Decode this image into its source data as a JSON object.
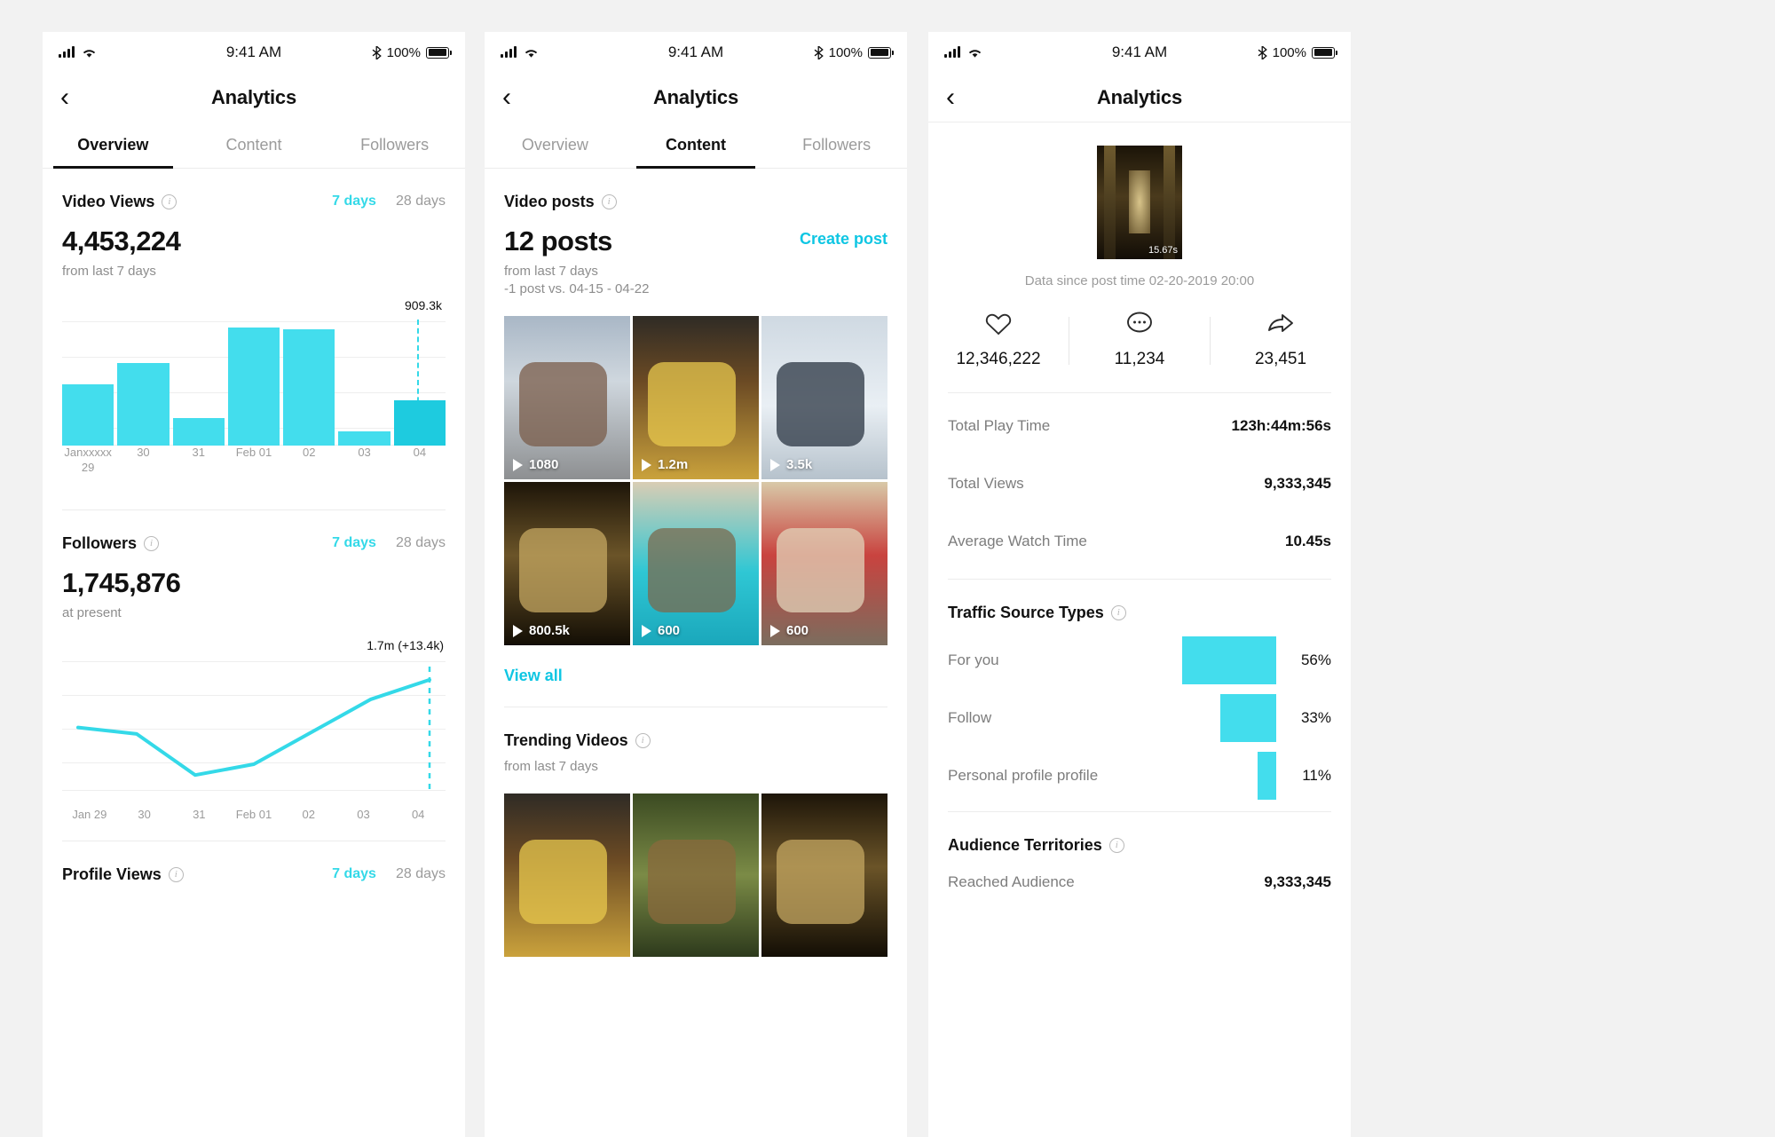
{
  "status_bar": {
    "time": "9:41 AM",
    "battery": "100%",
    "icons": [
      "signal-bars-icon",
      "wifi-icon",
      "bluetooth-icon",
      "battery-icon"
    ]
  },
  "colors": {
    "accent": "#34d9e8",
    "bar": "#43dded",
    "bar_highlight": "#1ecbdf",
    "link": "#0fc6e3",
    "text": "#111111",
    "muted": "#9b9b9b"
  },
  "nav": {
    "title": "Analytics",
    "back_icon": "chevron-left-icon"
  },
  "panel1": {
    "tabs": [
      {
        "label": "Overview",
        "active": true
      },
      {
        "label": "Content",
        "active": false
      },
      {
        "label": "Followers",
        "active": false
      }
    ],
    "video_views": {
      "title": "Video Views",
      "range_7": "7 days",
      "range_28": "28 days",
      "value": "4,453,224",
      "subtitle": "from last 7 days",
      "peak_label": "909.3k"
    },
    "followers": {
      "title": "Followers",
      "range_7": "7 days",
      "range_28": "28 days",
      "value": "1,745,876",
      "subtitle": "at present",
      "peak_label": "1.7m (+13.4k)"
    },
    "profile_views": {
      "title": "Profile Views",
      "range_7": "7 days",
      "range_28": "28 days"
    }
  },
  "panel2": {
    "tabs": [
      {
        "label": "Overview",
        "active": false
      },
      {
        "label": "Content",
        "active": true
      },
      {
        "label": "Followers",
        "active": false
      }
    ],
    "video_posts": {
      "title": "Video posts",
      "value": "12 posts",
      "subtitle": "from last 7 days",
      "subtitle2": "-1 post vs. 04-15 - 04-22",
      "create_post": "Create post",
      "view_all": "View all",
      "posts": [
        {
          "plays": "1080",
          "theme": "city"
        },
        {
          "plays": "1.2m",
          "theme": "burger"
        },
        {
          "plays": "3.5k",
          "theme": "snow"
        },
        {
          "plays": "800.5k",
          "theme": "corridor"
        },
        {
          "plays": "600",
          "theme": "venice"
        },
        {
          "plays": "600",
          "theme": "cafe"
        }
      ]
    },
    "trending": {
      "title": "Trending Videos",
      "subtitle": "from last 7 days",
      "posts": [
        {
          "theme": "burger"
        },
        {
          "theme": "deer"
        },
        {
          "theme": "corridor"
        }
      ]
    }
  },
  "panel3": {
    "thumb_duration": "15.67s",
    "data_since": "Data since post time 02-20-2019 20:00",
    "engagement": [
      {
        "icon": "heart-icon",
        "value": "12,346,222"
      },
      {
        "icon": "comment-icon",
        "value": "11,234"
      },
      {
        "icon": "share-icon",
        "value": "23,451"
      }
    ],
    "stats": [
      {
        "label": "Total Play Time",
        "value": "123h:44m:56s"
      },
      {
        "label": "Total Views",
        "value": "9,333,345"
      },
      {
        "label": "Average Watch Time",
        "value": "10.45s"
      }
    ],
    "traffic": {
      "title": "Traffic Source Types",
      "rows": [
        {
          "label": "For you",
          "pct": "56%"
        },
        {
          "label": "Follow",
          "pct": "33%"
        },
        {
          "label": "Personal profile profile",
          "pct": "11%"
        }
      ]
    },
    "audience": {
      "title": "Audience Territories",
      "row_label": "Reached Audience",
      "row_value": "9,333,345"
    }
  },
  "chart_data": [
    {
      "type": "bar",
      "title": "Video Views",
      "categories": [
        "Janxxxxx\n29",
        "30",
        "31",
        "Feb 01",
        "02",
        "03",
        "04"
      ],
      "tick_labels": [
        "Janxxxxx 29",
        "30",
        "31",
        "Feb 01",
        "02",
        "03",
        "04"
      ],
      "values": [
        520,
        700,
        230,
        1000,
        980,
        120,
        380
      ],
      "value_labels": [
        "",
        "",
        "",
        "",
        "",
        "",
        "909.3k"
      ],
      "highlight_index": 6,
      "annotation": "909.3k",
      "ylim": [
        0,
        1050
      ],
      "grid": true,
      "xlabel": "",
      "ylabel": ""
    },
    {
      "type": "line",
      "title": "Followers",
      "x": [
        "Jan 29",
        "30",
        "31",
        "Feb 01",
        "02",
        "03",
        "04"
      ],
      "values": [
        52,
        46,
        8,
        18,
        48,
        78,
        96
      ],
      "annotation": "1.7m (+13.4k)",
      "ylim": [
        0,
        100
      ],
      "grid": true,
      "xlabel": "",
      "ylabel": ""
    },
    {
      "type": "bar",
      "orientation": "horizontal",
      "title": "Traffic Source Types",
      "categories": [
        "For you",
        "Follow",
        "Personal profile profile"
      ],
      "values": [
        56,
        33,
        11
      ],
      "value_labels": [
        "56%",
        "33%",
        "11%"
      ],
      "ylim": [
        0,
        100
      ],
      "grid": false
    }
  ]
}
